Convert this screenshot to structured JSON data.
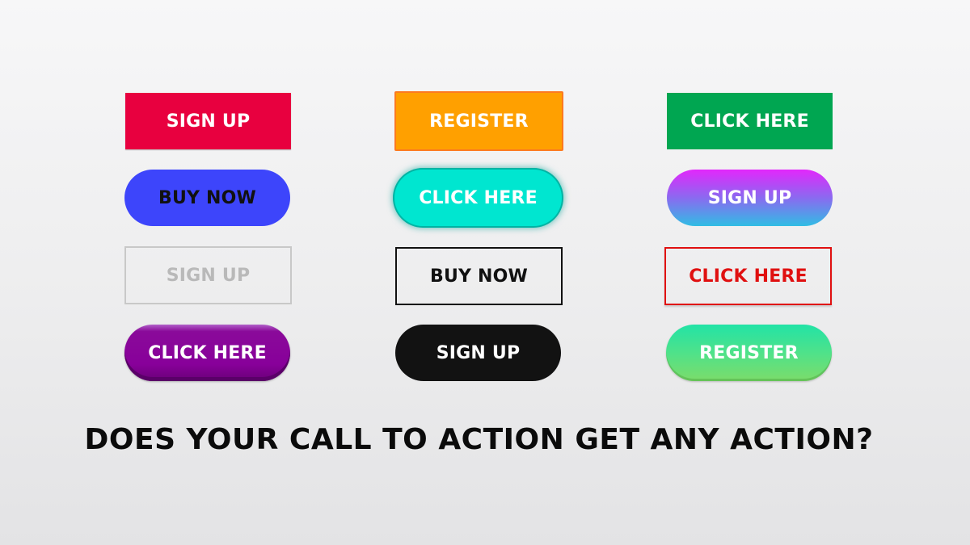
{
  "buttons": [
    {
      "label": "SIGN UP",
      "style": "solid-crimson",
      "color": "#e8003f"
    },
    {
      "label": "REGISTER",
      "style": "solid-orange-bordered",
      "color": "#ffa000"
    },
    {
      "label": "CLICK HERE",
      "style": "solid-green",
      "color": "#00a651"
    },
    {
      "label": "BUY NOW",
      "style": "pill-blue",
      "color": "#3d45fb"
    },
    {
      "label": "CLICK HERE",
      "style": "pill-turquoise-glow",
      "color": "#00e6d0"
    },
    {
      "label": "SIGN UP",
      "style": "pill-gradient-magenta-cyan",
      "color": "#e227fb"
    },
    {
      "label": "SIGN UP",
      "style": "outline-gray",
      "color": "#c8c8c8"
    },
    {
      "label": "BUY NOW",
      "style": "outline-black",
      "color": "#111111"
    },
    {
      "label": "CLICK HERE",
      "style": "outline-red",
      "color": "#e01010"
    },
    {
      "label": "CLICK HERE",
      "style": "pill-purple-3d",
      "color": "#88009a"
    },
    {
      "label": "SIGN UP",
      "style": "pill-black",
      "color": "#121212"
    },
    {
      "label": "REGISTER",
      "style": "pill-gradient-green",
      "color": "#4fe28a"
    }
  ],
  "headline": "DOES YOUR CALL TO ACTION GET ANY ACTION?"
}
